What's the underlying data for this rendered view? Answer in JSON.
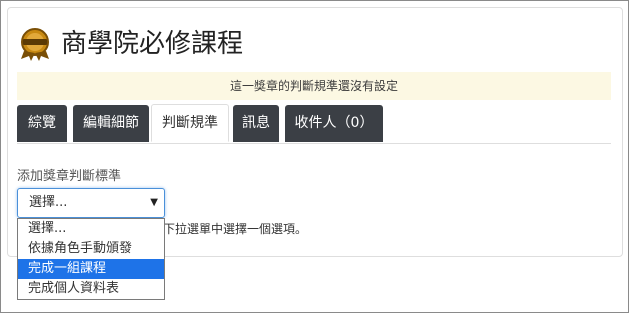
{
  "page": {
    "title": "商學院必修課程",
    "notice": "這一獎章的判斷規準還沒有設定"
  },
  "tabs": [
    {
      "label": "綜覽",
      "active": false
    },
    {
      "label": "編輯細節",
      "active": false
    },
    {
      "label": "判斷規準",
      "active": true
    },
    {
      "label": "訊息",
      "active": false
    },
    {
      "label": "收件人（0）",
      "active": false
    }
  ],
  "criteria": {
    "label": "添加獎章判斷標準",
    "select_value": "選擇...",
    "help_text": "從下拉選單中選擇一個選項。",
    "options": [
      {
        "label": "選擇...",
        "selected": false
      },
      {
        "label": "依據角色手動頒發",
        "selected": false
      },
      {
        "label": "完成一組課程",
        "selected": true
      },
      {
        "label": "完成個人資料表",
        "selected": false
      }
    ]
  },
  "colors": {
    "tab_bg": "#3b3f45",
    "notice_bg": "#fcf8e3",
    "selected_option": "#1e73e8",
    "badge": "#c98a12"
  },
  "icons": {
    "badge": "medal-badge-icon",
    "select_arrow": "▼"
  }
}
